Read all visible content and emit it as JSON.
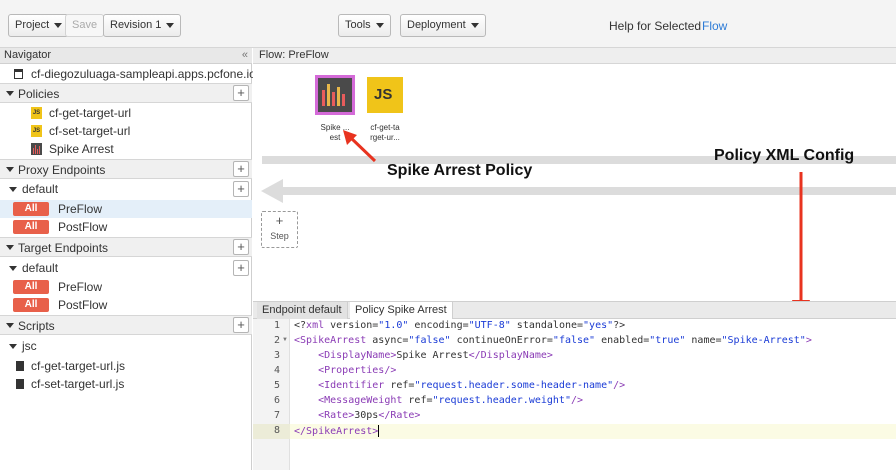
{
  "toolbar": {
    "project": "Project",
    "save": "Save",
    "revision": "Revision 1",
    "tools": "Tools",
    "deployment": "Deployment",
    "help_text": "Help for Selected",
    "help_link": "Flow"
  },
  "navigator": {
    "title": "Navigator",
    "proxy_name": "cf-diegozuluaga-sampleapi.apps.pcfone.io",
    "policies_label": "Policies",
    "policies": [
      "cf-get-target-url",
      "cf-set-target-url",
      "Spike Arrest"
    ],
    "proxy_endpoints_label": "Proxy Endpoints",
    "proxy_default": "default",
    "proxy_flows": [
      {
        "badge": "All",
        "name": "PreFlow"
      },
      {
        "badge": "All",
        "name": "PostFlow"
      }
    ],
    "target_endpoints_label": "Target Endpoints",
    "target_default": "default",
    "target_flows": [
      {
        "badge": "All",
        "name": "PreFlow"
      },
      {
        "badge": "All",
        "name": "PostFlow"
      }
    ],
    "scripts_label": "Scripts",
    "scripts_folder": "jsc",
    "scripts": [
      "cf-get-target-url.js",
      "cf-set-target-url.js"
    ]
  },
  "flow": {
    "title": "Flow: PreFlow",
    "policy1_label_a": "Spike ...",
    "policy1_label_b": "est",
    "policy2_badge": "JS",
    "policy2_label_a": "cf-get-ta",
    "policy2_label_b": "rget-ur...",
    "step_plus": "+",
    "step_label": "Step",
    "annotation_policy": "Spike Arrest Policy",
    "annotation_xml": "Policy XML Config"
  },
  "editor": {
    "tabs": [
      "Endpoint default",
      "Policy Spike Arrest"
    ],
    "line_numbers": [
      "1",
      "2",
      "3",
      "4",
      "5",
      "6",
      "7",
      "8"
    ]
  }
}
